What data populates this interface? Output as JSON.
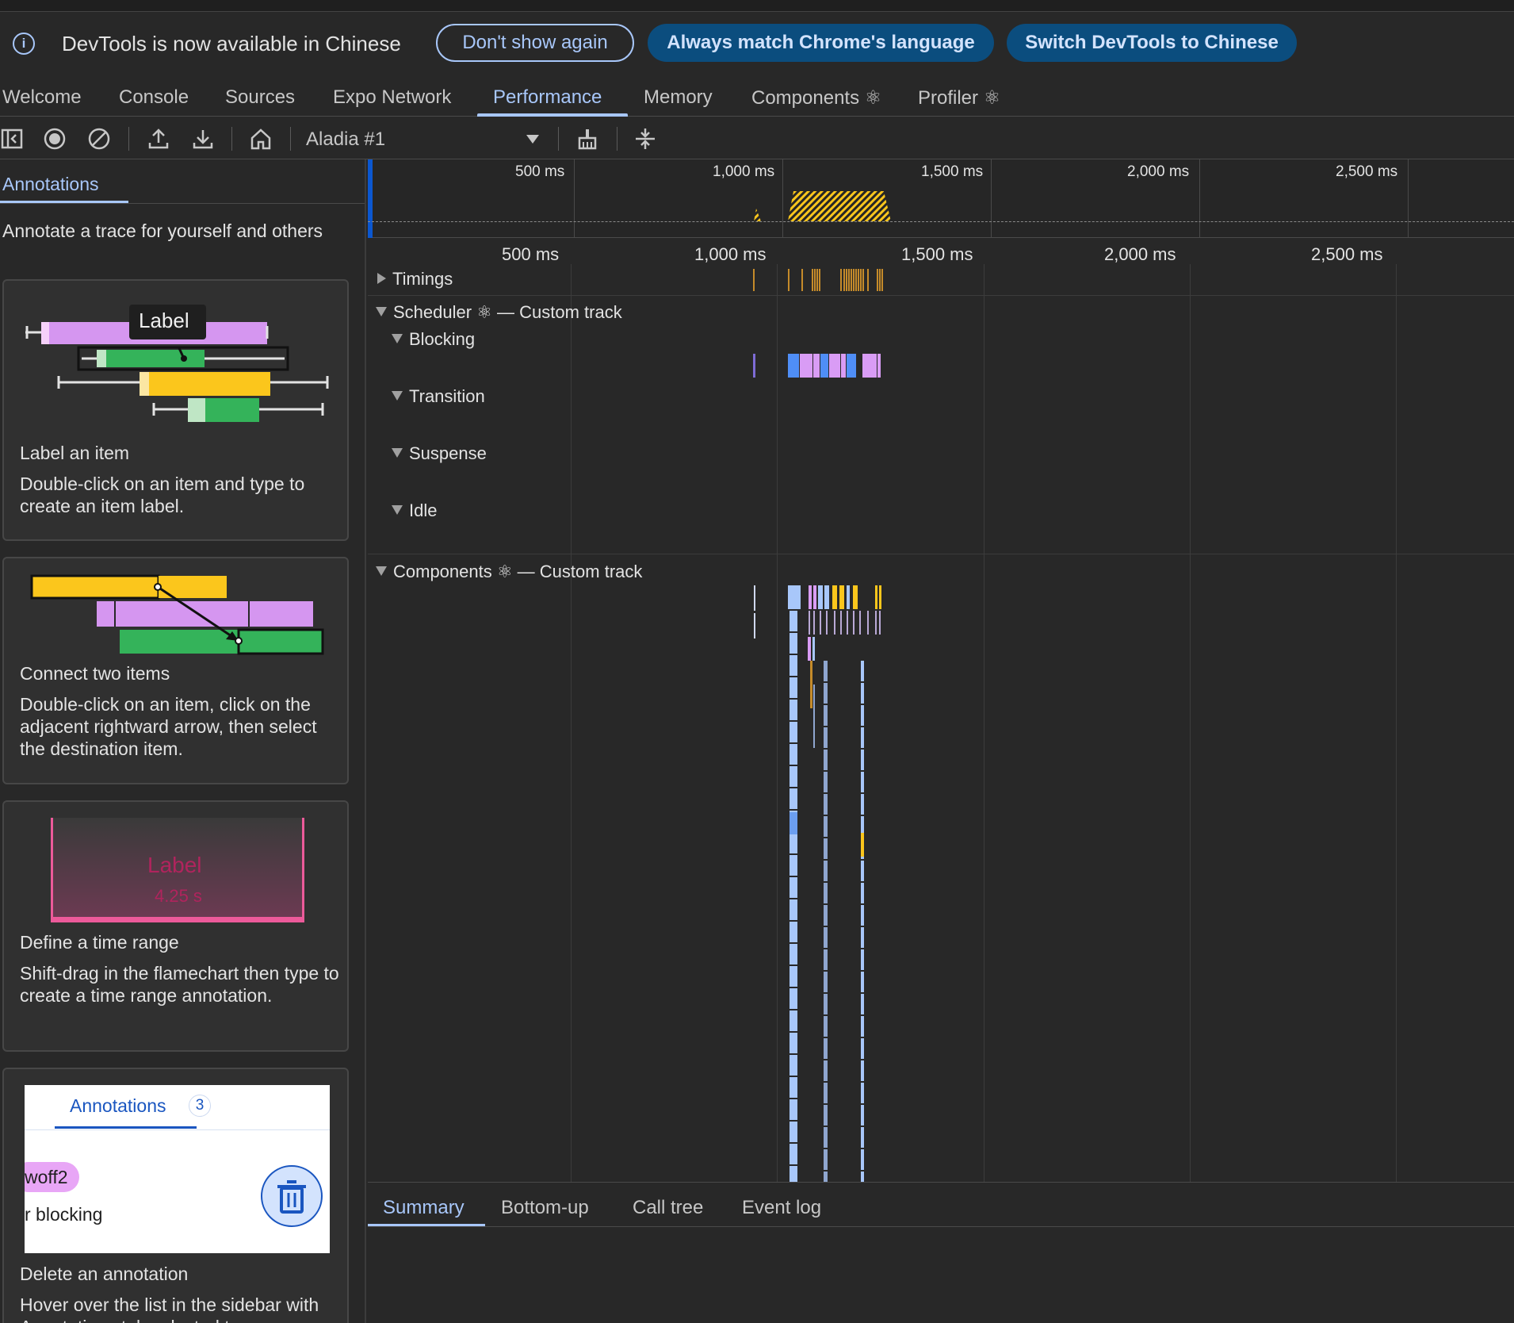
{
  "infobar": {
    "message": "DevTools is now available in Chinese",
    "dont_show": "Don't show again",
    "always_match": "Always match Chrome's language",
    "switch": "Switch DevTools to Chinese"
  },
  "main_tabs": [
    "Welcome",
    "Console",
    "Sources",
    "Expo Network",
    "Performance",
    "Memory",
    "Components ⚛",
    "Profiler ⚛"
  ],
  "active_main_tab": "Performance",
  "toolbar": {
    "target": "Aladia #1"
  },
  "sidebar": {
    "tab_label": "Annotations",
    "intro": "Annotate a trace for yourself and others",
    "cards": [
      {
        "title": "Label an item",
        "desc": "Double-click on an item and type to create an item label.",
        "demo_label": "Label"
      },
      {
        "title": "Connect two items",
        "desc": "Double-click on an item, click on the adjacent rightward arrow, then select the destination item."
      },
      {
        "title": "Define a time range",
        "desc": "Shift-drag in the flamechart then type to create a time range annotation.",
        "demo_label": "Label",
        "demo_duration": "4.25 s"
      },
      {
        "title": "Delete an annotation",
        "desc": "Hover over the list in the sidebar with Annotations tab selected to",
        "demo_tab": "Annotations",
        "demo_count": "3",
        "demo_chip": "woff2",
        "demo_text": "r blocking"
      }
    ]
  },
  "overview": {
    "ticks": [
      "500 ms",
      "1,000 ms",
      "1,500 ms",
      "2,000 ms",
      "2,500 ms"
    ]
  },
  "ruler": {
    "ticks": [
      "500 ms",
      "1,000 ms",
      "1,500 ms",
      "2,000 ms",
      "2,500 ms"
    ]
  },
  "tracks": {
    "timings": "Timings",
    "scheduler": "Scheduler ⚛ — Custom track",
    "blocking": "Blocking",
    "transition": "Transition",
    "suspense": "Suspense",
    "idle": "Idle",
    "components": "Components ⚛ — Custom track"
  },
  "bottom_tabs": [
    "Summary",
    "Bottom-up",
    "Call tree",
    "Event log"
  ],
  "colors": {
    "accent": "#a8c7fa",
    "purple": "#d99cf5",
    "green": "#34b35a",
    "yellow": "#fbc61c",
    "blue": "#a8c7fa",
    "timing": "#c58b2a"
  }
}
